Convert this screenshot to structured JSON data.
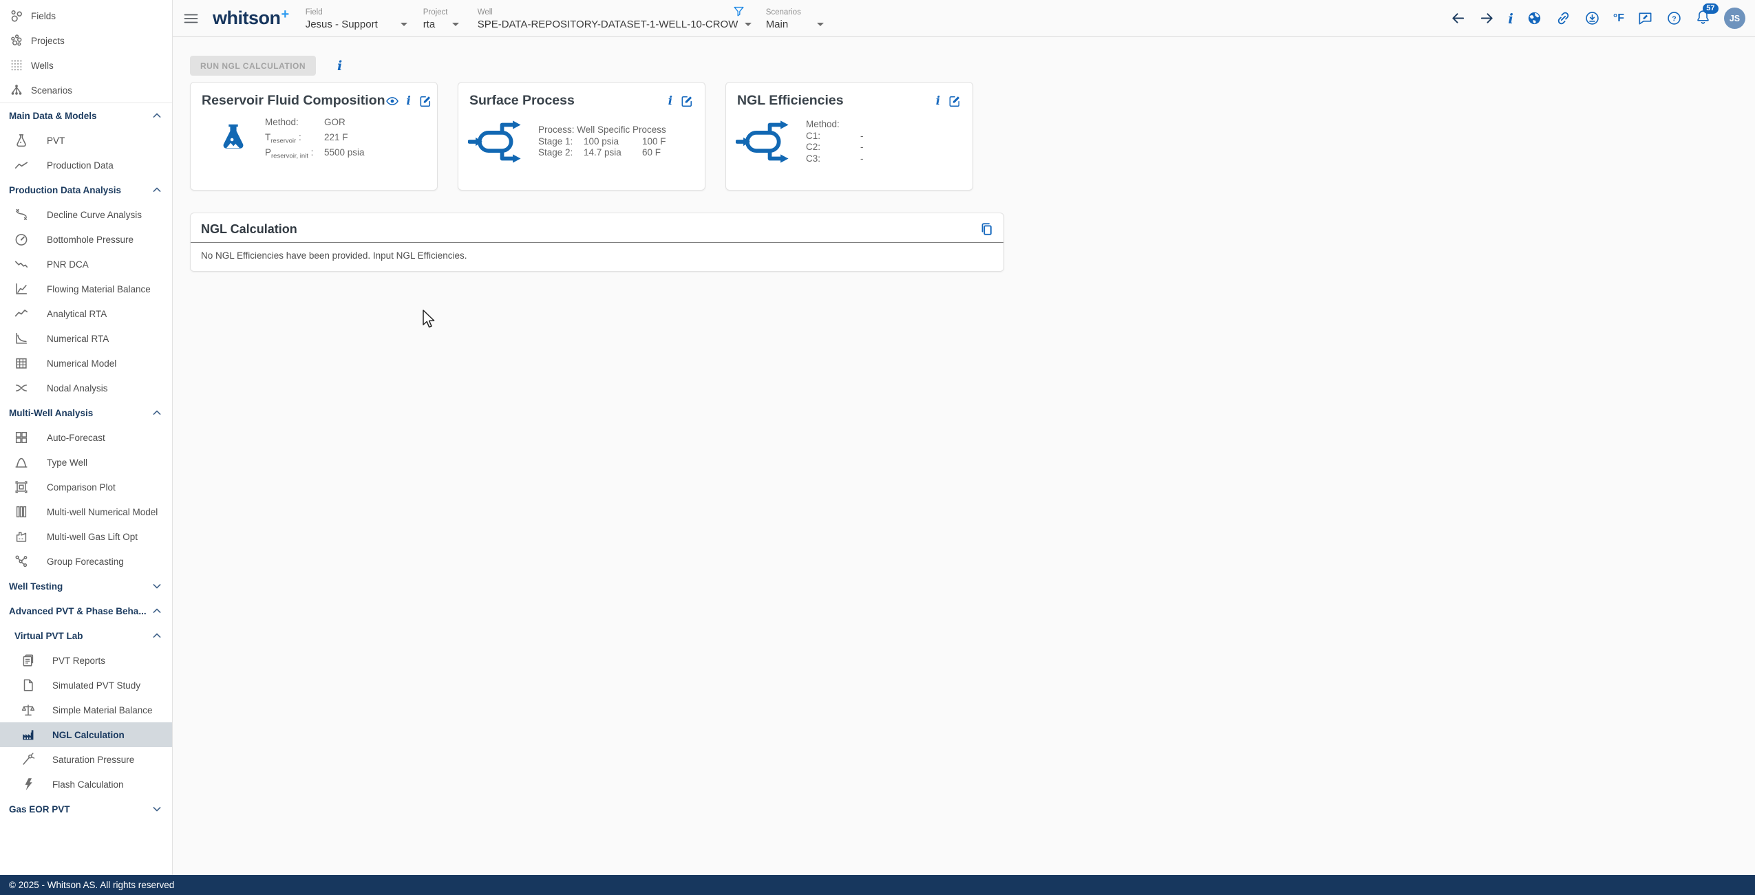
{
  "header": {
    "menu_icon": "hamburger-menu-icon",
    "logo_text": "whitson",
    "logo_plus": "+",
    "selectors": [
      {
        "label": "Field",
        "value": "Jesus - Support"
      },
      {
        "label": "Project",
        "value": "rta"
      },
      {
        "label": "Well",
        "value": "SPE-DATA-REPOSITORY-DATASET-1-WELL-10-CROW"
      },
      {
        "label": "Scenarios",
        "value": "Main"
      }
    ],
    "filter_icon": "filter-icon",
    "actions": [
      "back-icon",
      "forward-icon",
      "info-icon",
      "globe-icon",
      "link-icon",
      "export-icon",
      "temperature-unit-toggle",
      "feedback-icon",
      "help-icon",
      "notifications-icon",
      "user-avatar"
    ],
    "info_glyph": "i",
    "temp_unit": "°F",
    "notification_count": "57",
    "avatar_initials": "JS"
  },
  "sidebar": {
    "top_items": [
      {
        "icon": "fields-icon",
        "label": "Fields"
      },
      {
        "icon": "projects-icon",
        "label": "Projects"
      },
      {
        "icon": "wells-icon",
        "label": "Wells"
      },
      {
        "icon": "scenarios-icon",
        "label": "Scenarios"
      }
    ],
    "sections": [
      {
        "label": "Main Data & Models",
        "expanded": true,
        "items": [
          {
            "icon": "flask-icon",
            "label": "PVT"
          },
          {
            "icon": "trend-line-icon",
            "label": "Production Data"
          }
        ]
      },
      {
        "label": "Production Data Analysis",
        "expanded": true,
        "items": [
          {
            "icon": "decline-curve-icon",
            "label": "Decline Curve Analysis"
          },
          {
            "icon": "gauge-icon",
            "label": "Bottomhole Pressure"
          },
          {
            "icon": "pnr-dca-icon",
            "label": "PNR DCA"
          },
          {
            "icon": "fmb-chart-icon",
            "label": "Flowing Material Balance"
          },
          {
            "icon": "line-chart-icon",
            "label": "Analytical RTA"
          },
          {
            "icon": "curve-chart-icon",
            "label": "Numerical RTA"
          },
          {
            "icon": "building-icon",
            "label": "Numerical Model"
          },
          {
            "icon": "nodal-curves-icon",
            "label": "Nodal Analysis"
          }
        ]
      },
      {
        "label": "Multi-Well Analysis",
        "expanded": true,
        "items": [
          {
            "icon": "grid-icon",
            "label": "Auto-Forecast"
          },
          {
            "icon": "type-curve-icon",
            "label": "Type Well"
          },
          {
            "icon": "comparison-plot-icon",
            "label": "Comparison Plot"
          },
          {
            "icon": "columns-icon",
            "label": "Multi-well Numerical Model"
          },
          {
            "icon": "gas-lift-icon",
            "label": "Multi-well Gas Lift Opt"
          },
          {
            "icon": "group-network-icon",
            "label": "Group Forecasting"
          }
        ]
      },
      {
        "label": "Well Testing",
        "expanded": false,
        "items": []
      },
      {
        "label": "Advanced PVT & Phase Beha...",
        "expanded": true,
        "subsections": [
          {
            "label": "Virtual PVT Lab",
            "expanded": true,
            "items": [
              {
                "icon": "pvt-reports-icon",
                "label": "PVT Reports"
              },
              {
                "icon": "document-icon",
                "label": "Simulated PVT Study"
              },
              {
                "icon": "scales-icon",
                "label": "Simple Material Balance"
              },
              {
                "icon": "factory-icon",
                "label": "NGL Calculation",
                "selected": true
              },
              {
                "icon": "needle-icon",
                "label": "Saturation Pressure"
              },
              {
                "icon": "bolt-icon",
                "label": "Flash Calculation"
              }
            ]
          }
        ]
      },
      {
        "label": "Gas EOR PVT",
        "expanded": false,
        "items": []
      }
    ]
  },
  "main": {
    "run_button_label": "RUN NGL CALCULATION",
    "info_glyph": "i",
    "cards": [
      {
        "title": "Reservoir Fluid Composition",
        "icon": "flask-icon",
        "header_icons": [
          "eye-icon",
          "info-icon",
          "edit-icon"
        ],
        "rows": [
          {
            "pre": "Method:",
            "sub": "",
            "post": "",
            "value": "GOR"
          },
          {
            "pre": "T",
            "sub": "reservoir",
            "post": " :",
            "value": "221 F"
          },
          {
            "pre": "P",
            "sub": "reservoir, init",
            "post": " :",
            "value": "5500 psia"
          }
        ]
      },
      {
        "title": "Surface Process",
        "icon": "separator-icon",
        "header_icons": [
          "info-icon",
          "edit-icon"
        ],
        "process_line": "Process: Well Specific Process",
        "rows": [
          {
            "label": "Stage 1:",
            "pressure": "100 psia",
            "temperature": "100 F"
          },
          {
            "label": "Stage 2:",
            "pressure": "14.7 psia",
            "temperature": "60 F"
          }
        ]
      },
      {
        "title": "NGL Efficiencies",
        "icon": "separator-icon",
        "header_icons": [
          "info-icon",
          "edit-icon"
        ],
        "rows": [
          {
            "label": "Method:",
            "value": ""
          },
          {
            "label": "C1:",
            "value": "-"
          },
          {
            "label": "C2:",
            "value": "-"
          },
          {
            "label": "C3:",
            "value": "-"
          }
        ]
      }
    ],
    "ngl_section": {
      "title": "NGL Calculation",
      "copy_icon": "copy-icon",
      "message": "No NGL Efficiencies have been provided. Input NGL Efficiencies."
    }
  },
  "footer": {
    "copyright": "© 2025 - Whitson AS. All rights reserved"
  }
}
